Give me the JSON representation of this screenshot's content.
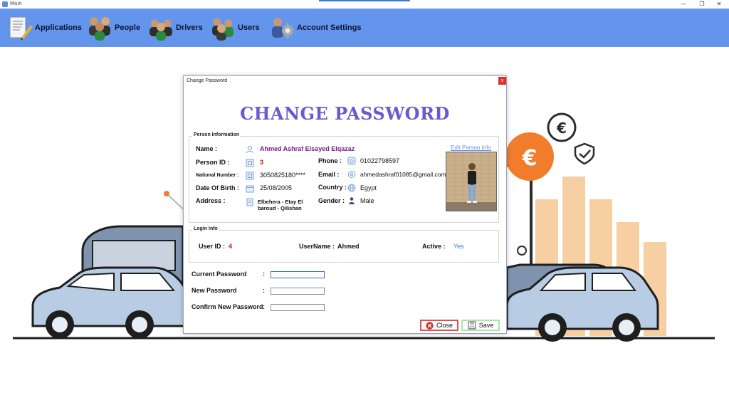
{
  "window": {
    "title": "Main",
    "controls": {
      "minimize": "—",
      "restore": "❐",
      "close": "✕"
    }
  },
  "toolbar": {
    "items": [
      {
        "label": "Applications",
        "icon": "document-pen-icon"
      },
      {
        "label": "People",
        "icon": "people-group-icon"
      },
      {
        "label": "Drivers",
        "icon": "drivers-group-icon"
      },
      {
        "label": "Users",
        "icon": "users-group-icon"
      },
      {
        "label": "Account Settings",
        "icon": "account-settings-icon"
      }
    ]
  },
  "illustration": {
    "currency_symbol": "€"
  },
  "dialog": {
    "title": "Change Password",
    "close_glyph": "x",
    "heading": "CHANGE PASSWORD",
    "person_info": {
      "group_label": "Person Information",
      "edit_link": "Edit Person Info",
      "labels": {
        "name": "Name :",
        "person_id": "Person ID :",
        "national_number": "National Number :",
        "date_of_birth": "Date Of Birth :",
        "address": "Address :",
        "phone": "Phone :",
        "email": "Email :",
        "country": "Country :",
        "gender": "Gender :"
      },
      "values": {
        "name": "Ahmed Ashraf Elsayed Elqazaz",
        "person_id": "3",
        "national_number": "3050825180****",
        "date_of_birth": "25/08/2005",
        "address_line1": "Elbehera - Etay El",
        "address_line2": "baroud - Qilishan",
        "phone": "01022798597",
        "email": "ahmedashraf01085@gmail.com",
        "country": "Egypt",
        "gender": "Male"
      }
    },
    "login_info": {
      "group_label": "Login Info",
      "user_id_label": "User ID :",
      "user_id": "4",
      "username_label": "UserName :",
      "username": "Ahmed",
      "active_label": "Active :",
      "active": "Yes"
    },
    "password_form": {
      "current_label": "Current Password",
      "new_label": "New Password",
      "confirm_label": "Confirm New Password",
      "colon": ":",
      "current_value": "",
      "new_value": "",
      "confirm_value": ""
    },
    "buttons": {
      "close": "Close",
      "save": "Save"
    }
  },
  "colors": {
    "toolbar": "#6495ed",
    "heading": "#6a5acd",
    "accent_red": "#d01010",
    "name_purple": "#7a1a8a",
    "link_blue": "#6b8fe8",
    "active_blue": "#3a78d8"
  }
}
